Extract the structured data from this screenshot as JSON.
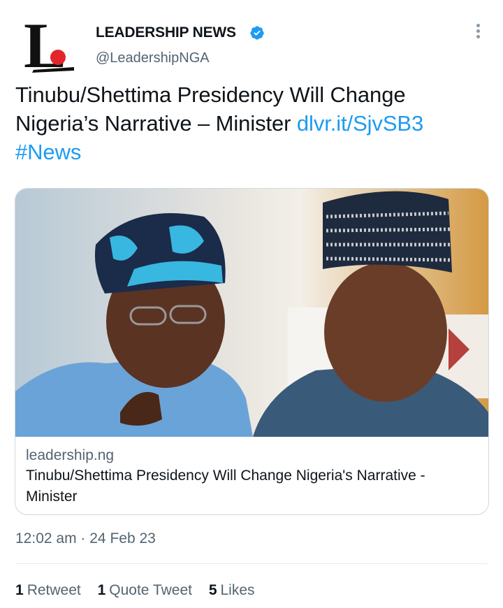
{
  "author": {
    "name": "LEADERSHIP NEWS",
    "handle": "@LeadershipNGA",
    "logo_letter": "L",
    "verified_icon": "verified-badge-icon"
  },
  "tweet": {
    "text": "Tinubu/Shettima Presidency Will Change Nigeria’s Narrative – Minister",
    "link": "dlvr.it/SjvSB3",
    "hashtag": "#News"
  },
  "card": {
    "domain": "leadership.ng",
    "title": "Tinubu/Shettima Presidency Will Change Nigeria's Narrative - Minister",
    "image": "photo of two men, left in blue patterned cap pointing, right in dark embroidered cap"
  },
  "meta": {
    "time": "12:02 am",
    "separator": "·",
    "date": "24 Feb 23"
  },
  "stats": {
    "retweets_count": "1",
    "retweets_label": "Retweet",
    "quotes_count": "1",
    "quotes_label": "Quote Tweet",
    "likes_count": "5",
    "likes_label": "Likes"
  },
  "colors": {
    "link": "#1d9bf0",
    "secondary_text": "#536471",
    "primary_text": "#0f1419",
    "logo_red": "#e3262b"
  }
}
